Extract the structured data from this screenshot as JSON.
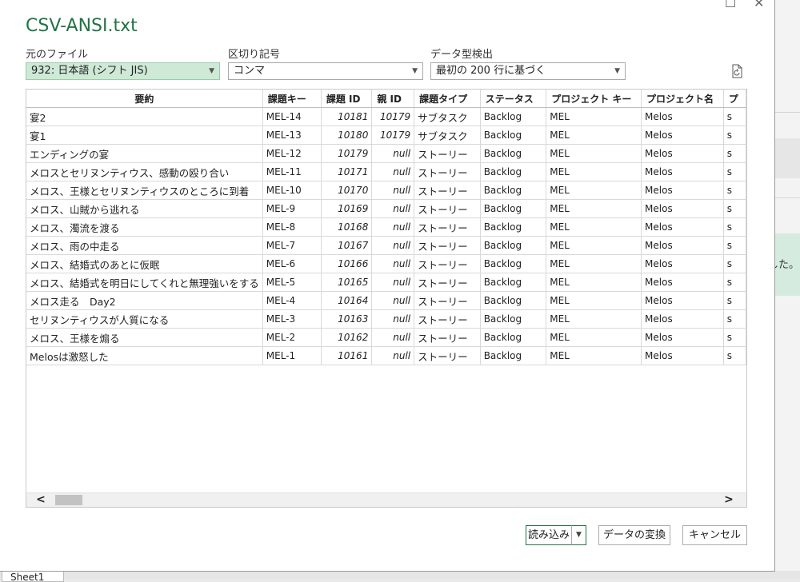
{
  "dialog": {
    "title": "CSV-ANSI.txt"
  },
  "controls": {
    "origin_label": "元のファイル",
    "origin_value": "932: 日本語 (シフト JIS)",
    "delimiter_label": "区切り記号",
    "delimiter_value": "コンマ",
    "detect_label": "データ型検出",
    "detect_value": "最初の 200 行に基づく"
  },
  "table": {
    "headers": [
      "要約",
      "課題キー",
      "課題 ID",
      "親 ID",
      "課題タイプ",
      "ステータス",
      "プロジェクト キー",
      "プロジェクト名",
      "プ"
    ],
    "rows": [
      [
        "宴2",
        "MEL-14",
        "10181",
        "10179",
        "サブタスク",
        "Backlog",
        "MEL",
        "Melos",
        "s"
      ],
      [
        "宴1",
        "MEL-13",
        "10180",
        "10179",
        "サブタスク",
        "Backlog",
        "MEL",
        "Melos",
        "s"
      ],
      [
        "エンディングの宴",
        "MEL-12",
        "10179",
        "null",
        "ストーリー",
        "Backlog",
        "MEL",
        "Melos",
        "s"
      ],
      [
        "メロスとセリヌンティウス、感動の殴り合い",
        "MEL-11",
        "10171",
        "null",
        "ストーリー",
        "Backlog",
        "MEL",
        "Melos",
        "s"
      ],
      [
        "メロス、王様とセリヌンティウスのところに到着",
        "MEL-10",
        "10170",
        "null",
        "ストーリー",
        "Backlog",
        "MEL",
        "Melos",
        "s"
      ],
      [
        "メロス、山賊から逃れる",
        "MEL-9",
        "10169",
        "null",
        "ストーリー",
        "Backlog",
        "MEL",
        "Melos",
        "s"
      ],
      [
        "メロス、濁流を渡る",
        "MEL-8",
        "10168",
        "null",
        "ストーリー",
        "Backlog",
        "MEL",
        "Melos",
        "s"
      ],
      [
        "メロス、雨の中走る",
        "MEL-7",
        "10167",
        "null",
        "ストーリー",
        "Backlog",
        "MEL",
        "Melos",
        "s"
      ],
      [
        "メロス、結婚式のあとに仮眠",
        "MEL-6",
        "10166",
        "null",
        "ストーリー",
        "Backlog",
        "MEL",
        "Melos",
        "s"
      ],
      [
        "メロス、結婚式を明日にしてくれと無理強いをする",
        "MEL-5",
        "10165",
        "null",
        "ストーリー",
        "Backlog",
        "MEL",
        "Melos",
        "s"
      ],
      [
        "メロス走る　Day2",
        "MEL-4",
        "10164",
        "null",
        "ストーリー",
        "Backlog",
        "MEL",
        "Melos",
        "s"
      ],
      [
        "セリヌンティウスが人質になる",
        "MEL-3",
        "10163",
        "null",
        "ストーリー",
        "Backlog",
        "MEL",
        "Melos",
        "s"
      ],
      [
        "メロス、王様を煽る",
        "MEL-2",
        "10162",
        "null",
        "ストーリー",
        "Backlog",
        "MEL",
        "Melos",
        "s"
      ],
      [
        "Melosは激怒した",
        "MEL-1",
        "10161",
        "null",
        "ストーリー",
        "Backlog",
        "MEL",
        "Melos",
        "s"
      ]
    ]
  },
  "buttons": {
    "load": "読み込み",
    "transform": "データの変換",
    "cancel": "キャンセル"
  },
  "background": {
    "right_text": "した。",
    "sheet_tab": "Sheet1"
  },
  "icons": {
    "maximize": "maximize-icon",
    "close": "close-icon",
    "refresh": "refresh-icon"
  },
  "colors": {
    "accent": "#217346",
    "highlight": "#cfe9d7"
  }
}
